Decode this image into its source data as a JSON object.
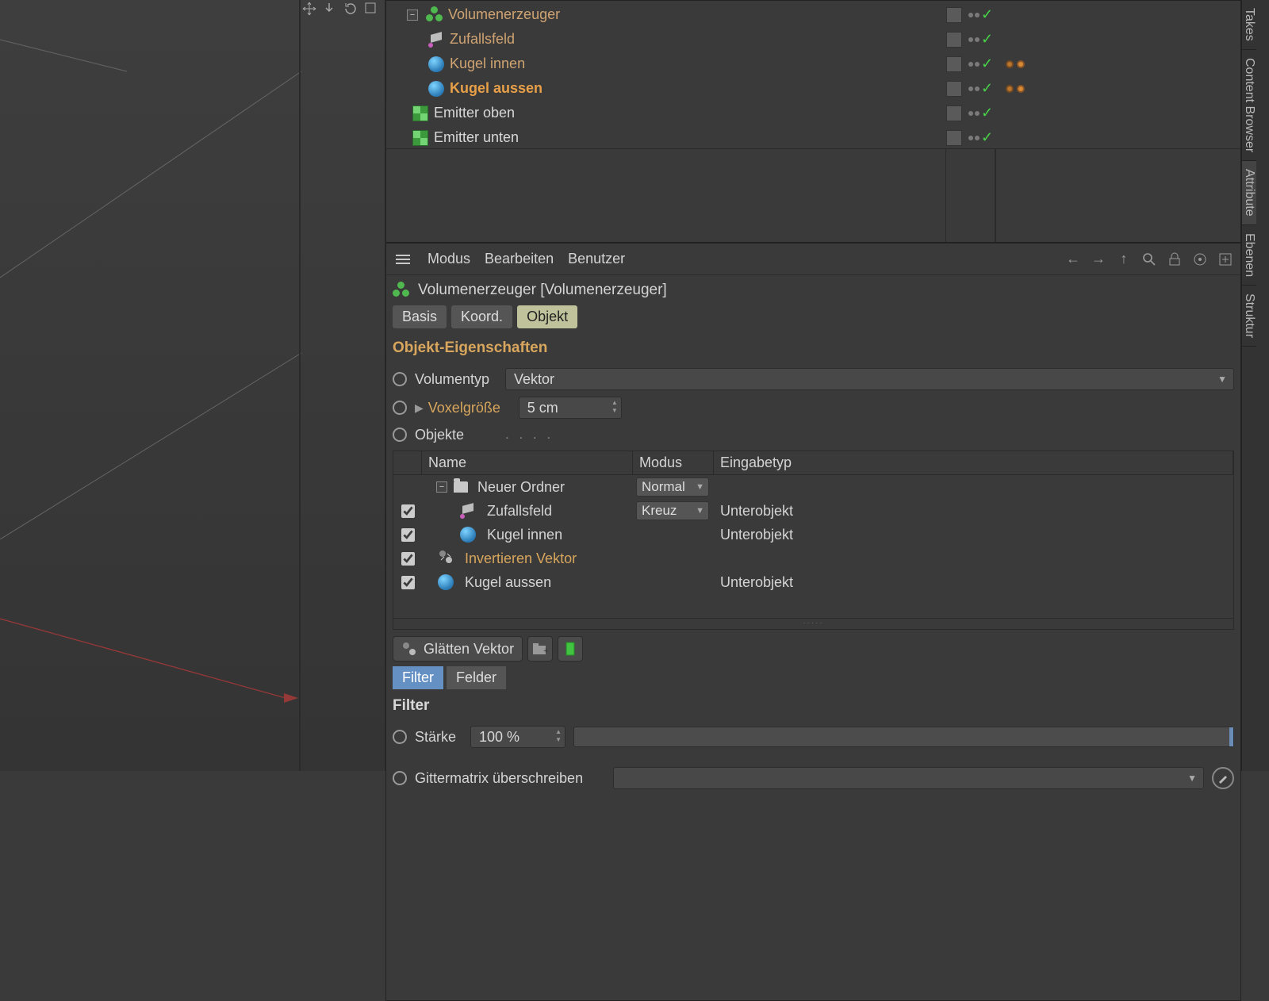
{
  "viewport_tool_icons": [
    "move",
    "down",
    "rotate",
    "frame"
  ],
  "object_tree": {
    "items": [
      {
        "name": "Volumenerzeuger",
        "kind": "volume",
        "selected": false,
        "indent": 0,
        "expandable": true
      },
      {
        "name": "Zufallsfeld",
        "kind": "random",
        "selected": false,
        "indent": 1
      },
      {
        "name": "Kugel innen",
        "kind": "sphere",
        "selected": false,
        "indent": 1,
        "tags": true
      },
      {
        "name": "Kugel aussen",
        "kind": "sphere",
        "selected": true,
        "indent": 1,
        "tags": true
      },
      {
        "name": "Emitter oben",
        "kind": "emitter",
        "white": true,
        "indent": 0
      },
      {
        "name": "Emitter unten",
        "kind": "emitter",
        "white": true,
        "indent": 0
      }
    ]
  },
  "attr_menu": {
    "modus": "Modus",
    "bearbeiten": "Bearbeiten",
    "benutzer": "Benutzer"
  },
  "attr_title": "Volumenerzeuger [Volumenerzeuger]",
  "attr_tabs": {
    "basis": "Basis",
    "koord": "Koord.",
    "objekt": "Objekt"
  },
  "section_obj_prop": "Objekt-Eigenschaften",
  "props": {
    "volumentyp_label": "Volumentyp",
    "volumentyp_value": "Vektor",
    "voxel_label": "Voxelgröße",
    "voxel_value": "5 cm",
    "objekte_label": "Objekte"
  },
  "obj_list_headers": {
    "name": "Name",
    "modus": "Modus",
    "eingabetyp": "Eingabetyp"
  },
  "obj_list": [
    {
      "checked": null,
      "label": "Neuer Ordner",
      "kind": "folder",
      "mode": "Normal",
      "type": "",
      "indent": 0,
      "expandable": true
    },
    {
      "checked": true,
      "label": "Zufallsfeld",
      "kind": "random",
      "mode": "Kreuz",
      "type": "Unterobjekt",
      "indent": 1
    },
    {
      "checked": true,
      "label": "Kugel innen",
      "kind": "sphere",
      "mode": "",
      "type": "Unterobjekt",
      "indent": 1
    },
    {
      "checked": true,
      "label": "Invertieren Vektor",
      "kind": "invert",
      "mode": "",
      "type": "",
      "indent": 0,
      "orange": true
    },
    {
      "checked": true,
      "label": "Kugel aussen",
      "kind": "sphere",
      "mode": "",
      "type": "Unterobjekt",
      "indent": 0
    }
  ],
  "glaetten_btn": "Glätten Vektor",
  "filter_tabs": {
    "filter": "Filter",
    "felder": "Felder"
  },
  "filter_section": "Filter",
  "staerke_label": "Stärke",
  "staerke_value": "100 %",
  "gittermatrix_label": "Gittermatrix überschreiben",
  "right_tabs": {
    "takes": "Takes",
    "content": "Content Browser",
    "attribute": "Attribute",
    "ebenen": "Ebenen",
    "struktur": "Struktur"
  }
}
